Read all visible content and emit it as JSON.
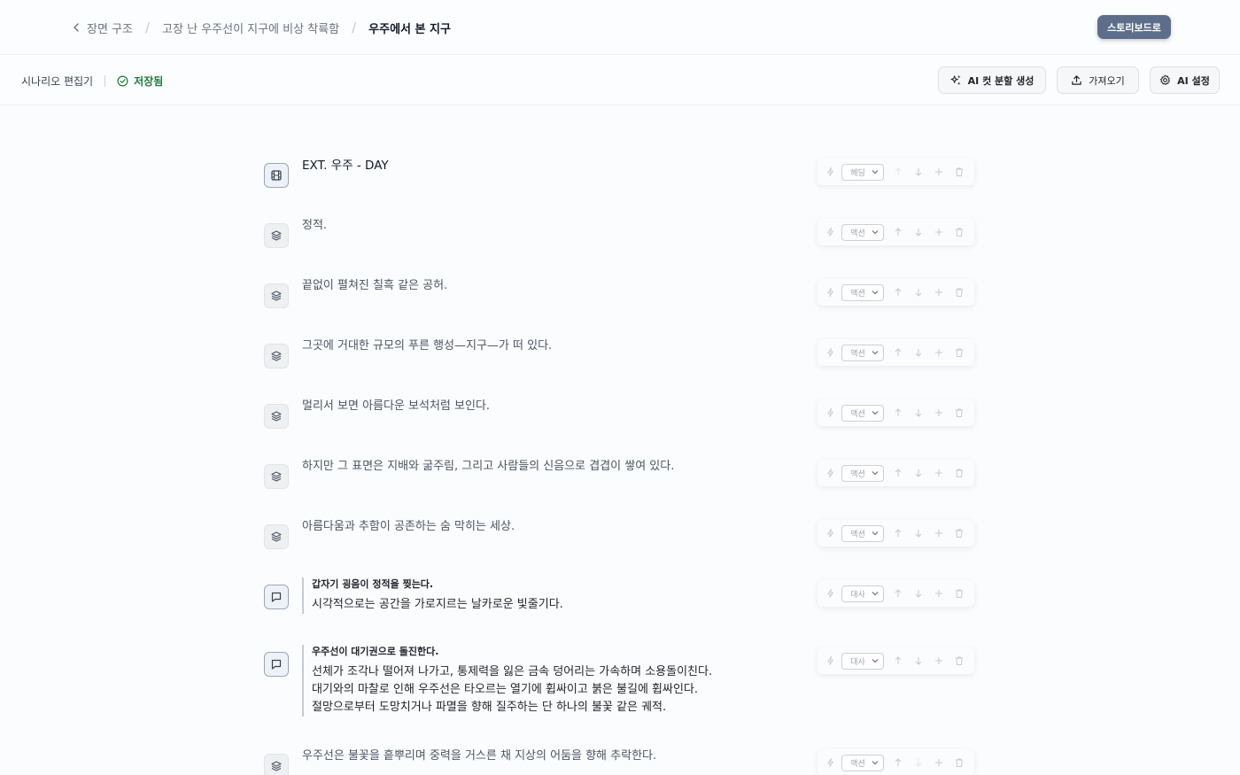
{
  "header": {
    "breadcrumbs": [
      "장면 구조",
      "고장 난 우주선이 지구에 비상 착륙함",
      "우주에서 본 지구"
    ],
    "storyboard_button": "스토리보드로"
  },
  "toolbar": {
    "title": "시나리오 편집기",
    "status": "저장됨",
    "ai_split_button": "AI 컷 분할 생성",
    "import_button": "가져오기",
    "ai_settings_button": "AI 설정"
  },
  "blocks": [
    {
      "type_label": "헤딩",
      "text": "EXT. 우주 - DAY"
    },
    {
      "type_label": "액션",
      "text": "정적."
    },
    {
      "type_label": "액션",
      "text": "끝없이 펼쳐진 칠흑 같은 공허."
    },
    {
      "type_label": "액션",
      "text": "그곳에 거대한 규모의 푸른 행성—지구—가 떠 있다."
    },
    {
      "type_label": "액션",
      "text": "멀리서 보면 아름다운 보석처럼 보인다."
    },
    {
      "type_label": "액션",
      "text": "하지만 그 표면은 지배와 굶주림, 그리고 사람들의 신음으로 겹겹이 쌓여 있다."
    },
    {
      "type_label": "액션",
      "text": "아름다움과 추함이 공존하는 숨 막히는 세상."
    },
    {
      "type_label": "대사",
      "character": "갑자기 굉음이 정적을 찢는다.",
      "lines": [
        "시각적으로는 공간을 가로지르는 날카로운 빛줄기다."
      ]
    },
    {
      "type_label": "대사",
      "character": "우주선이 대기권으로 돌진한다.",
      "lines": [
        "선체가 조각나 떨어져 나가고, 통제력을 잃은 금속 덩어리는 가속하며 소용돌이친다.",
        "대기와의 마찰로 인해 우주선은 타오르는 열기에 휩싸이고 붉은 불길에 휩싸인다.",
        "절망으로부터 도망치거나 파멸을 향해 질주하는 단 하나의 불꽃 같은 궤적."
      ]
    },
    {
      "type_label": "액션",
      "text": "우주선은 불꽃을 흩뿌리며 중력을 거스른 채 지상의 어둠을 향해 추락한다."
    }
  ]
}
